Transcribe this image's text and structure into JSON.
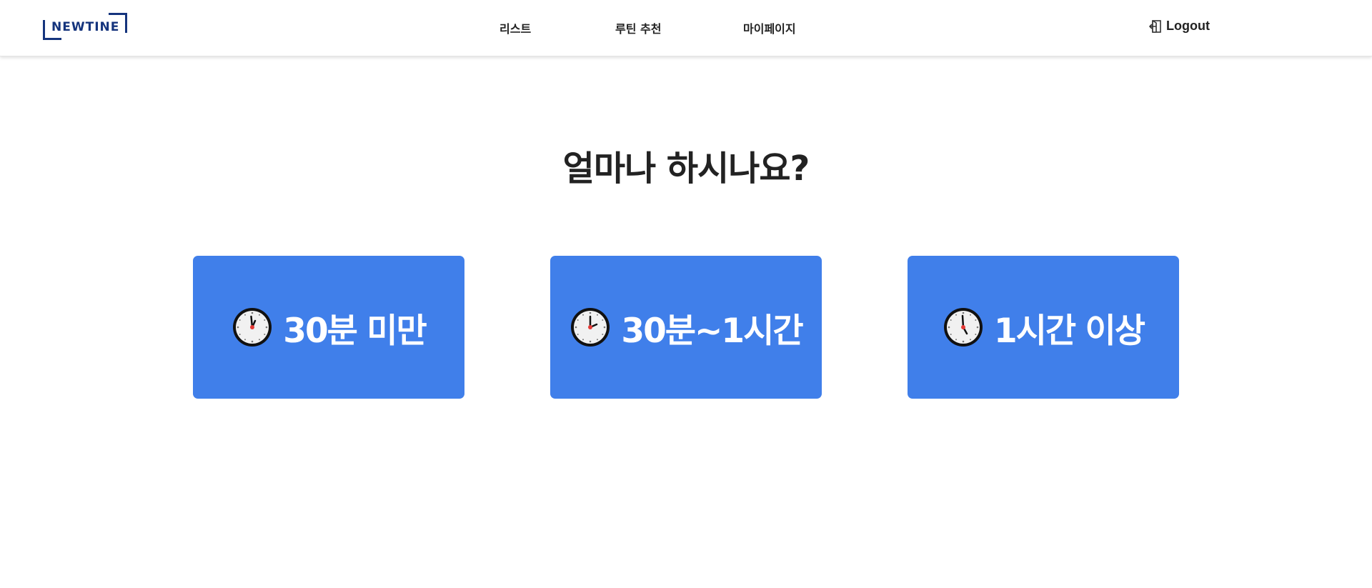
{
  "header": {
    "logo_text": "NEWTINE",
    "nav": [
      "리스트",
      "루틴 추천",
      "마이페이지"
    ],
    "logout_label": "Logout",
    "logout_icon": "logout-door-icon"
  },
  "main": {
    "title": "얼마나 하시나요?",
    "options": [
      {
        "label": "30분 미만",
        "icon": "clock-icon"
      },
      {
        "label": "30분~1시간",
        "icon": "clock-icon"
      },
      {
        "label": "1시간 이상",
        "icon": "clock-icon"
      }
    ]
  },
  "colors": {
    "brand": "#15347d",
    "card": "#407fea",
    "text": "#222222"
  }
}
